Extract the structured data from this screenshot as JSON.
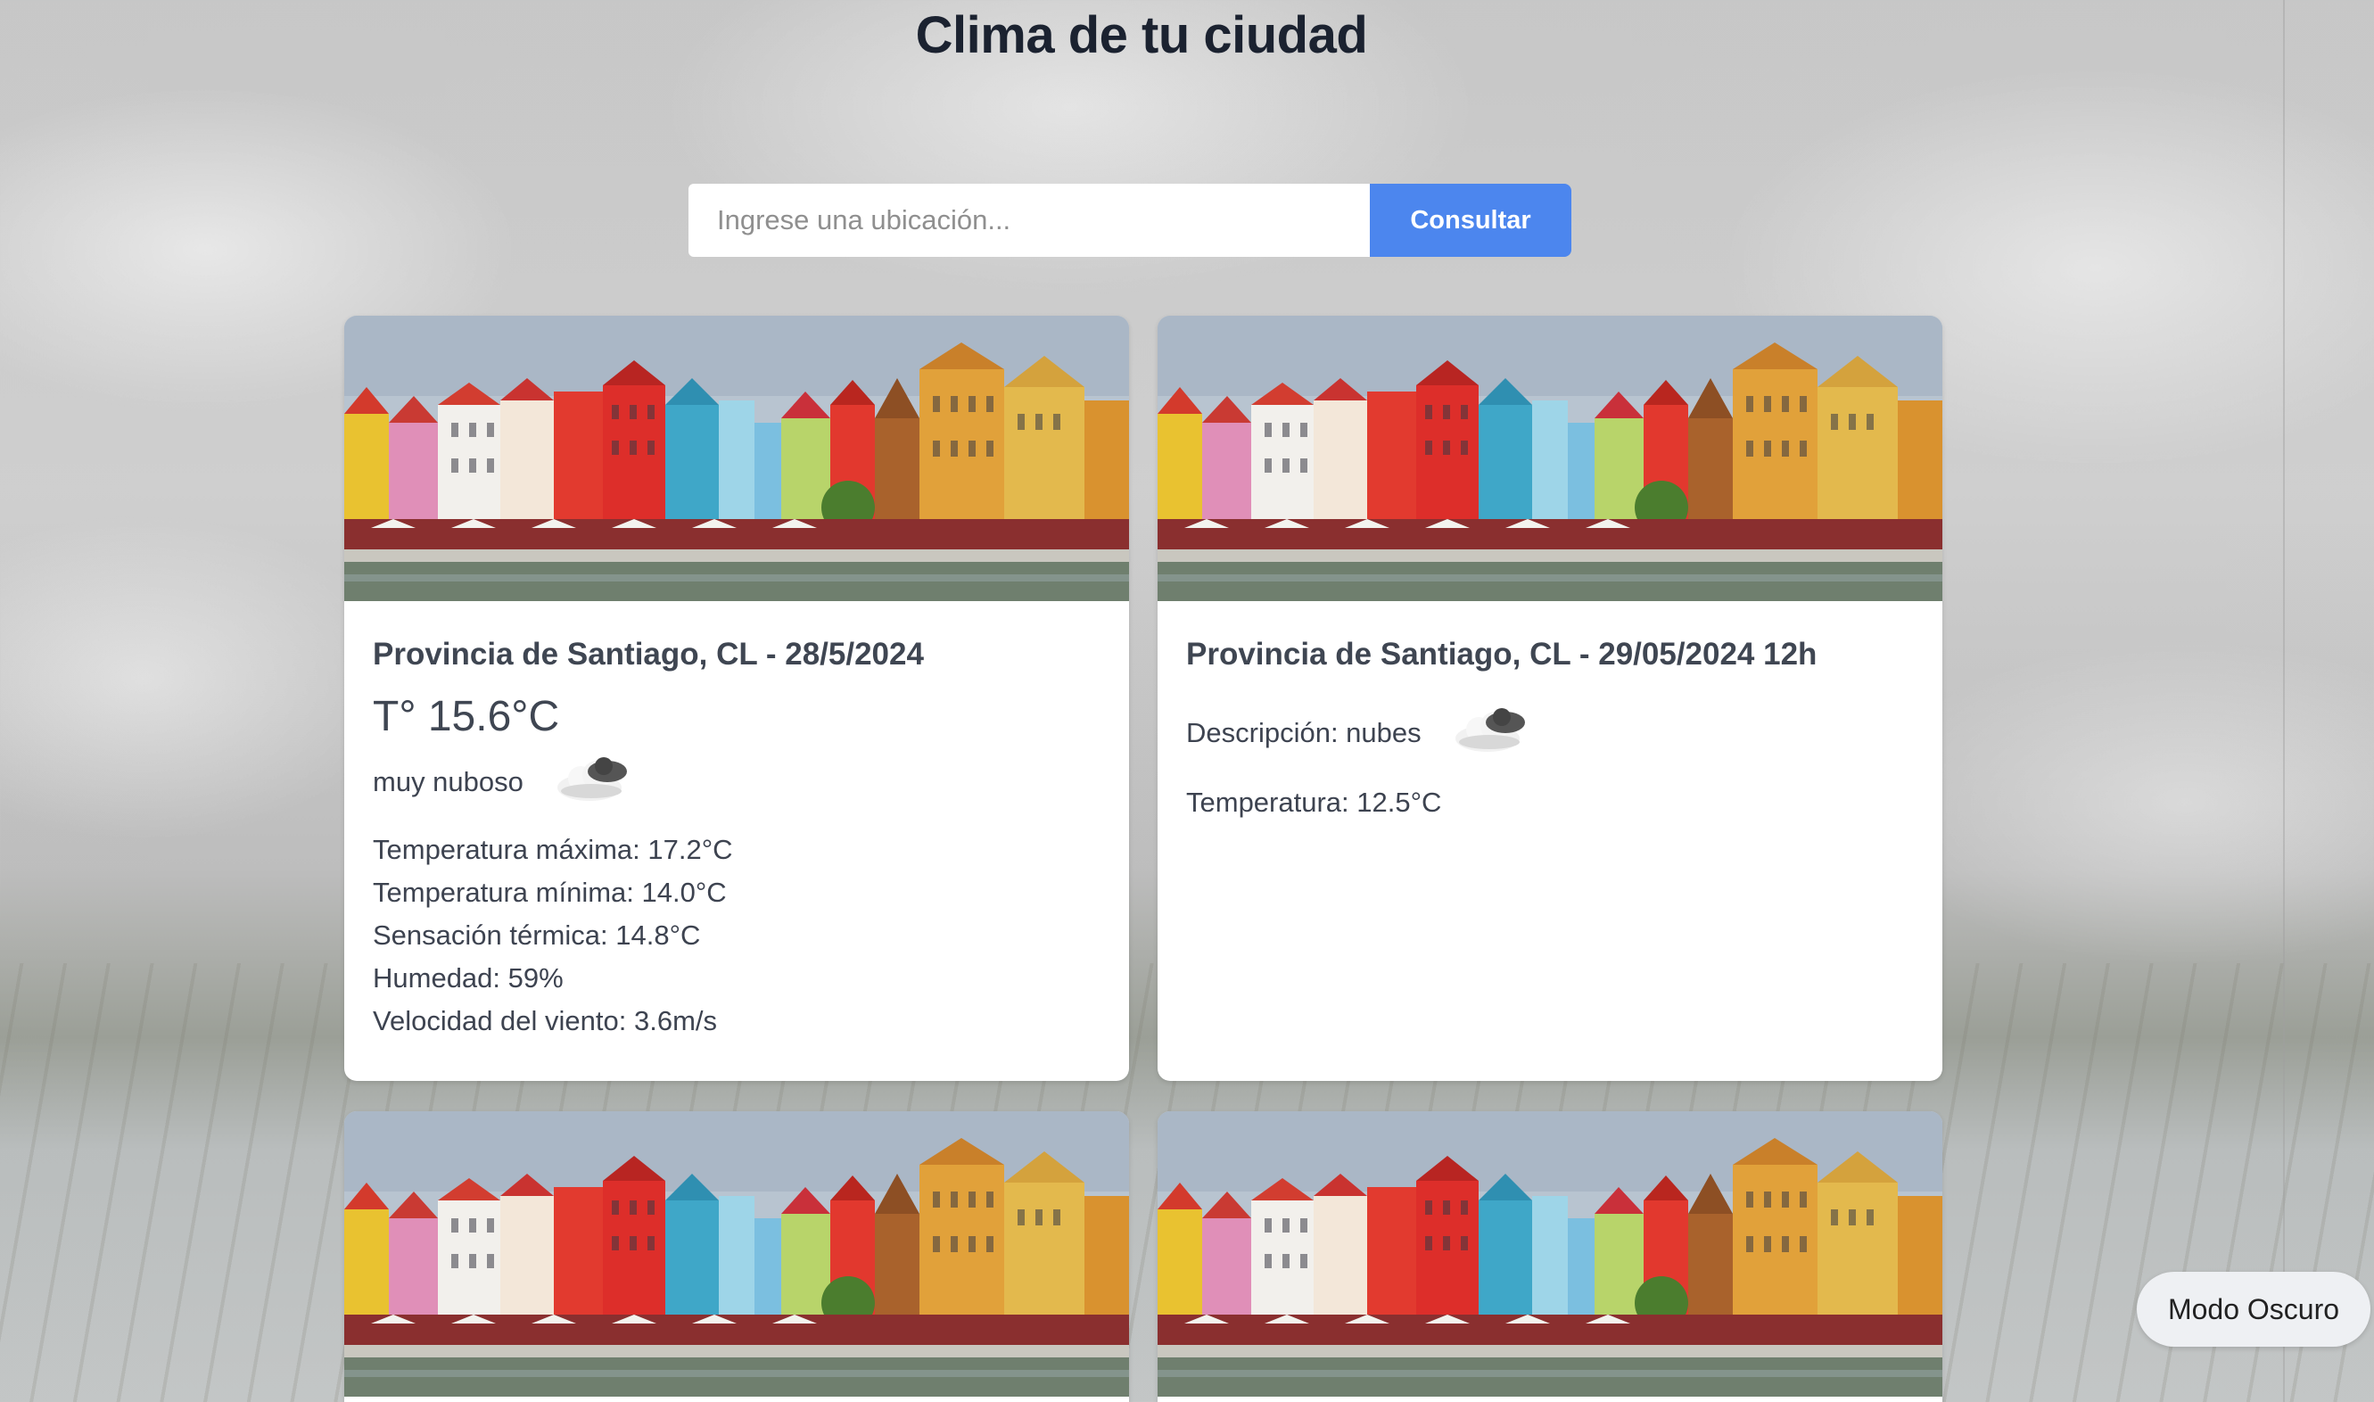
{
  "header": {
    "title": "Clima de tu ciudad"
  },
  "search": {
    "placeholder": "Ingrese una ubicación...",
    "value": "",
    "button_label": "Consultar"
  },
  "cards": [
    {
      "title": "Provincia de Santiago, CL - 28/5/2024",
      "temperature": "T° 15.6°C",
      "description": "muy nuboso",
      "icon": "cloud-icon",
      "details": [
        "Temperatura máxima: 17.2°C",
        "Temperatura mínima: 14.0°C",
        "Sensación térmica: 14.8°C",
        "Humedad: 59%",
        "Velocidad del viento: 3.6m/s"
      ]
    },
    {
      "title": "Provincia de Santiago, CL - 29/05/2024 12h",
      "description": "Descripción: nubes",
      "icon": "cloud-icon",
      "temperature_line": "Temperatura: 12.5°C"
    }
  ],
  "footer": {
    "dark_mode_label": "Modo Oscuro"
  },
  "colors": {
    "accent": "#4c86ee",
    "title": "#1b2230"
  }
}
